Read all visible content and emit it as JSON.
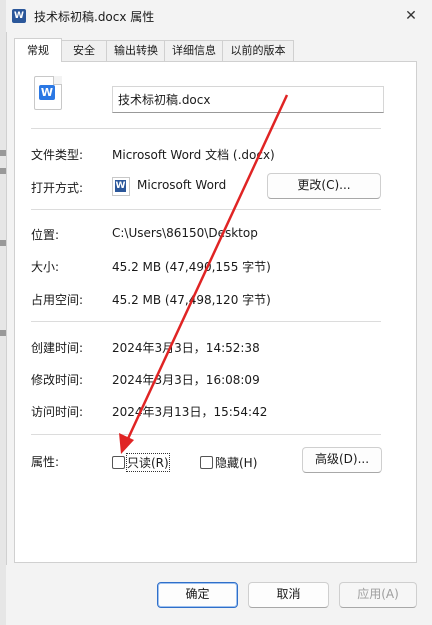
{
  "window": {
    "title": "技术标初稿.docx 属性",
    "close_glyph": "✕",
    "app_icon_letter": "W"
  },
  "tabs": [
    {
      "label": "常规"
    },
    {
      "label": "安全"
    },
    {
      "label": "输出转换"
    },
    {
      "label": "详细信息"
    },
    {
      "label": "以前的版本"
    }
  ],
  "general": {
    "file_icon_letter": "W",
    "filename": "技术标初稿.docx",
    "file_type_label": "文件类型:",
    "file_type_value": "Microsoft Word 文档 (.docx)",
    "open_with_label": "打开方式:",
    "open_with_icon_letter": "W",
    "open_with_value": "Microsoft Word",
    "change_button": "更改(C)...",
    "location_label": "位置:",
    "location_value": "C:\\Users\\86150\\Desktop",
    "size_label": "大小:",
    "size_value": "45.2 MB (47,490,155 字节)",
    "disk_size_label": "占用空间:",
    "disk_size_value": "45.2 MB (47,498,120 字节)",
    "created_label": "创建时间:",
    "created_value": "2024年3月3日，14:52:38",
    "modified_label": "修改时间:",
    "modified_value": "2024年3月3日，16:08:09",
    "accessed_label": "访问时间:",
    "accessed_value": "2024年3月13日，15:54:42",
    "attributes_label": "属性:",
    "readonly_label": "只读(R)",
    "hidden_label": "隐藏(H)",
    "advanced_button": "高级(D)..."
  },
  "footer": {
    "ok": "确定",
    "cancel": "取消",
    "apply": "应用(A)"
  },
  "colors": {
    "annotation_arrow": "#e02424",
    "word_blue": "#2b579a"
  }
}
